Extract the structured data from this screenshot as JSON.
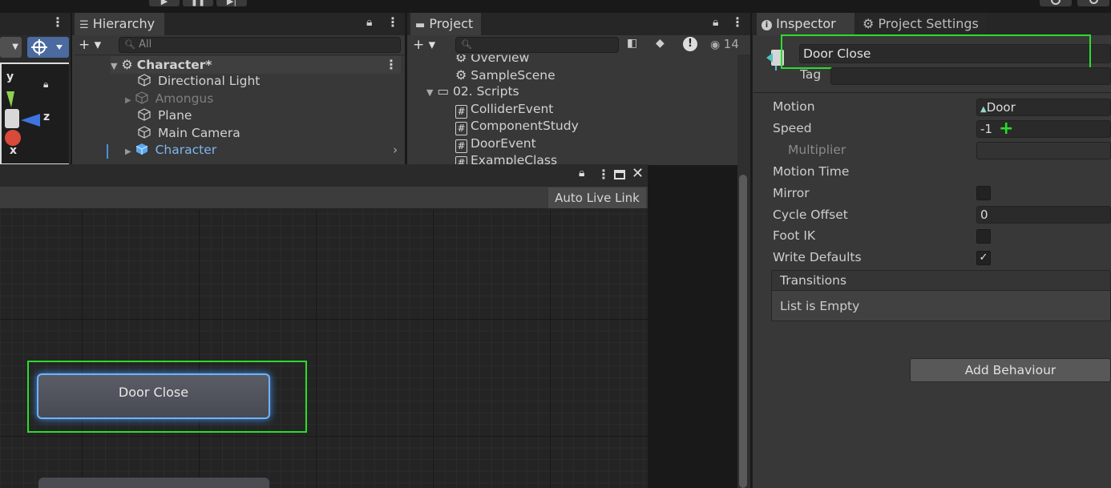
{
  "toolbar": {
    "play_glyph": "▶",
    "pause_glyph": "❚❚",
    "step_glyph": "▶|"
  },
  "hierarchy": {
    "tab_label": "Hierarchy",
    "add_label": "+ ▾",
    "search_placeholder": "All",
    "items": [
      {
        "label": "Character*"
      },
      {
        "label": "Directional Light"
      },
      {
        "label": "Amongus"
      },
      {
        "label": "Plane"
      },
      {
        "label": "Main Camera"
      },
      {
        "label": "Character"
      }
    ]
  },
  "scene_gizmo": {
    "y_label": "y",
    "z_label": "z",
    "x_label": "x"
  },
  "project": {
    "tab_label": "Project",
    "add_label": "+ ▾",
    "visible_count": "14",
    "items": [
      {
        "label": "Overview"
      },
      {
        "label": "SampleScene"
      },
      {
        "label": "02. Scripts"
      },
      {
        "label": "ColliderEvent"
      },
      {
        "label": "ComponentStudy"
      },
      {
        "label": "DoorEvent"
      },
      {
        "label": "ExampleClass"
      }
    ]
  },
  "animator": {
    "auto_live_link_label": "Auto Live Link",
    "state_label": "Door Close"
  },
  "inspector": {
    "tab_label": "Inspector",
    "settings_tab_label": "Project Settings",
    "state_name": "Door Close",
    "tag_label": "Tag",
    "motion_label": "Motion",
    "motion_value": "Door",
    "speed_label": "Speed",
    "speed_value": "-1",
    "multiplier_label": "Multiplier",
    "motion_time_label": "Motion Time",
    "mirror_label": "Mirror",
    "cycle_offset_label": "Cycle Offset",
    "cycle_offset_value": "0",
    "foot_ik_label": "Foot IK",
    "write_defaults_label": "Write Defaults",
    "write_defaults_glyph": "✓",
    "transitions_label": "Transitions",
    "list_empty_label": "List is Empty",
    "add_behaviour_label": "Add Behaviour"
  },
  "colors": {
    "highlight": "#2bdc2b",
    "selection_text": "#7fb6ec",
    "panel_bg": "#383838"
  }
}
